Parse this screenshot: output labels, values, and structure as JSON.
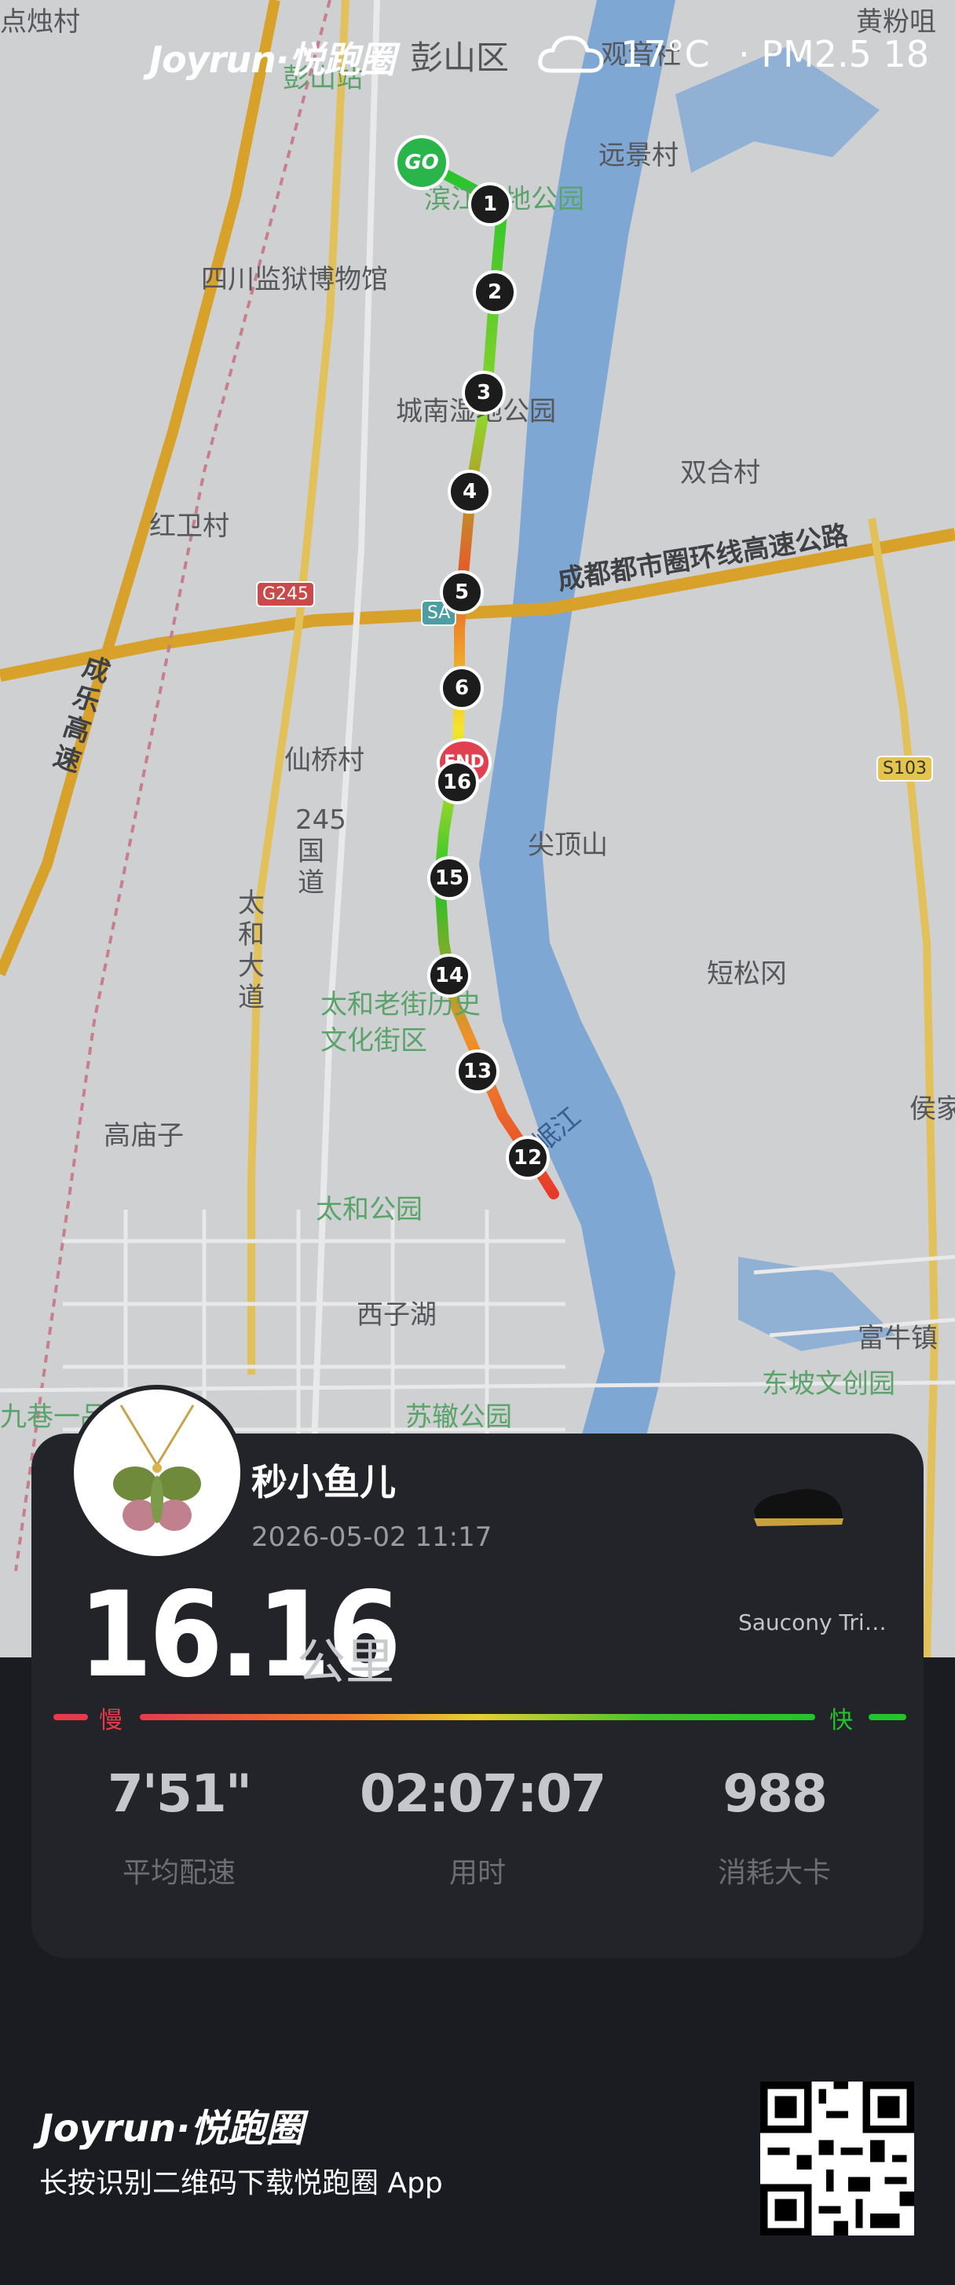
{
  "header": {
    "brand": "Joyrun·悦跑圈",
    "district": "彭山区",
    "temperature": "17°C",
    "air_quality": "· PM2.5 18",
    "weather_icon": "cloud-icon"
  },
  "map": {
    "labels": {
      "rongshanpo": "彭山站",
      "wetland_park": "滨江湿地公园",
      "yuanjing": "远景村",
      "prison_museum": "四川监狱博物馆",
      "chengnan_park": "城南湿地公园",
      "shuanghe": "双合村",
      "hongwei": "红卫村",
      "chengdu_ring": "成都都市圈环线高速公路",
      "chengle": "成乐高速",
      "xianqiao": "仙桥村",
      "jiantou": "尖顶山",
      "road245": "245国道",
      "taihe_road": "太和大道",
      "duansong": "短松冈",
      "taihe_old": "太和老街历史文化街区",
      "gaomiao": "高庙子",
      "minjiang": "岷江",
      "taihe_park": "太和公园",
      "xizi_lake": "西子湖",
      "fuliu": "富牛镇",
      "dongpo": "东坡文创园",
      "jiuxiang": "九巷一品公园",
      "sushi_park": "苏辙公园",
      "huangfen": "黄粉咀",
      "hou": "侯家",
      "laojiefang": "观音社",
      "dianzhuocun": "点烛村"
    },
    "shields": {
      "g245": "G245",
      "sa": "SA",
      "s103": "S103"
    },
    "go_label": "GO",
    "end_label": "END",
    "km_markers": [
      "1",
      "2",
      "3",
      "4",
      "5",
      "6",
      "16",
      "15",
      "14",
      "13",
      "12"
    ]
  },
  "activity": {
    "username": "秒小鱼儿",
    "datetime": "2026-05-02 11:17",
    "shoe_name": "Saucony Tri…",
    "distance": "16.16",
    "distance_unit": "公里",
    "slow_label": "慢",
    "fast_label": "快",
    "stats": [
      {
        "value": "7'51\"",
        "label": "平均配速"
      },
      {
        "value": "02:07:07",
        "label": "用时"
      },
      {
        "value": "988",
        "label": "消耗大卡"
      }
    ]
  },
  "footer": {
    "brand": "Joyrun·悦跑圈",
    "text": "长按识别二维码下载悦跑圈 App"
  },
  "colors": {
    "route_fast": "#22c42a",
    "route_mid": "#f5e52a",
    "route_slow": "#e83a2a",
    "river": "#7fa7d4",
    "highway": "#d8a22a"
  }
}
